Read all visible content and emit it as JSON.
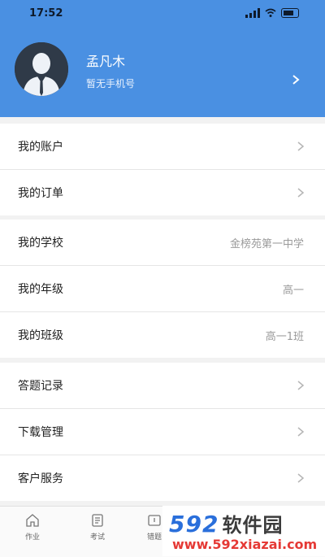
{
  "status_bar": {
    "time": "17:52"
  },
  "profile": {
    "name": "孟凡木",
    "phone_text": "暂无手机号"
  },
  "groups": [
    {
      "items": [
        {
          "label": "我的账户"
        },
        {
          "label": "我的订单"
        }
      ]
    },
    {
      "items": [
        {
          "label": "我的学校",
          "value": "金榜苑第一中学"
        },
        {
          "label": "我的年级",
          "value": "高一"
        },
        {
          "label": "我的班级",
          "value": "高一1班"
        }
      ]
    },
    {
      "items": [
        {
          "label": "答题记录"
        },
        {
          "label": "下载管理"
        },
        {
          "label": "客户服务"
        }
      ]
    }
  ],
  "tabbar": {
    "tabs": [
      {
        "label": "作业",
        "icon": "home-icon"
      },
      {
        "label": "考试",
        "icon": "exam-icon"
      },
      {
        "label": "错题",
        "icon": "wrong-question-icon"
      }
    ]
  },
  "watermark": {
    "brand_digits": "592",
    "brand_text": "软件园",
    "url": "www.592xiazai.com"
  },
  "colors": {
    "accent": "#4a90e2",
    "chevron": "#b5b5b5"
  }
}
